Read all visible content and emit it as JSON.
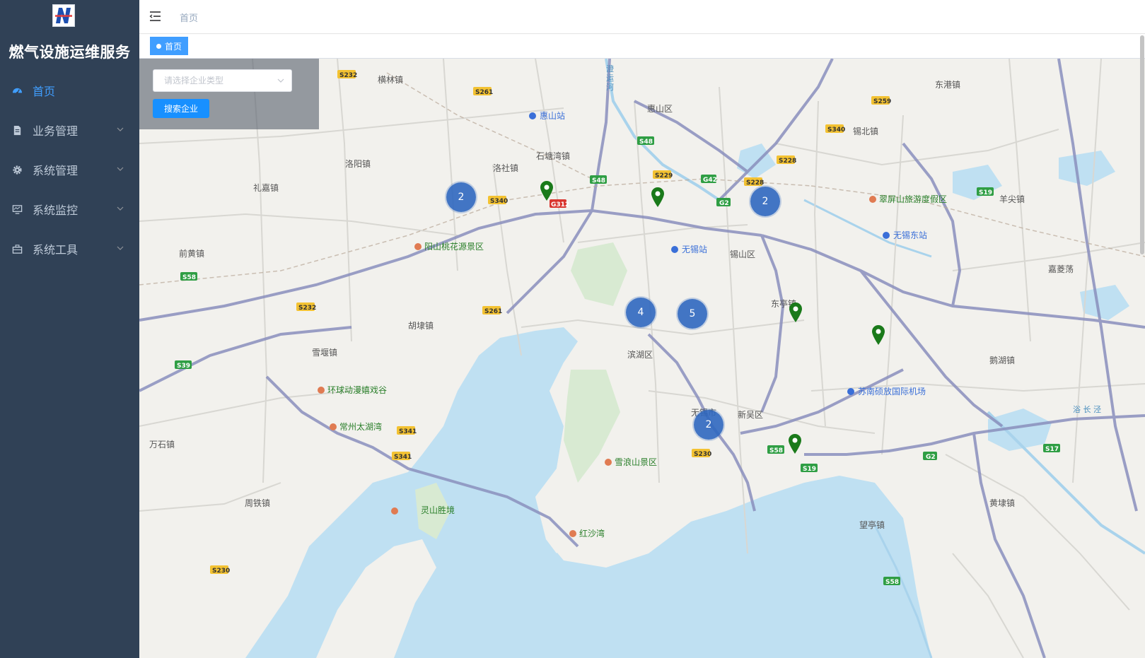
{
  "app": {
    "title": "燃气设施运维服务"
  },
  "sidebar": {
    "items": [
      {
        "label": "首页",
        "icon": "dashboard-icon",
        "active": true
      },
      {
        "label": "业务管理",
        "icon": "document-icon"
      },
      {
        "label": "系统管理",
        "icon": "gear-icon"
      },
      {
        "label": "系统监控",
        "icon": "monitor-icon"
      },
      {
        "label": "系统工具",
        "icon": "toolbox-icon"
      }
    ]
  },
  "navbar": {
    "breadcrumb": "首页"
  },
  "tags": {
    "active": "首页"
  },
  "search": {
    "placeholder": "请选择企业类型",
    "button": "搜索企业"
  },
  "map": {
    "clusters": [
      {
        "count": "2"
      },
      {
        "count": "2"
      },
      {
        "count": "4"
      },
      {
        "count": "5"
      },
      {
        "count": "2"
      }
    ],
    "colors": {
      "cluster": "#2f67bf",
      "pin": "#1a7a1a",
      "water": "#bfe0f2",
      "green": "#d8ead2",
      "highway": "#8a8fbd"
    }
  },
  "colors": {
    "sidebar": "#304156",
    "accent": "#409eff",
    "button": "#1890ff"
  }
}
